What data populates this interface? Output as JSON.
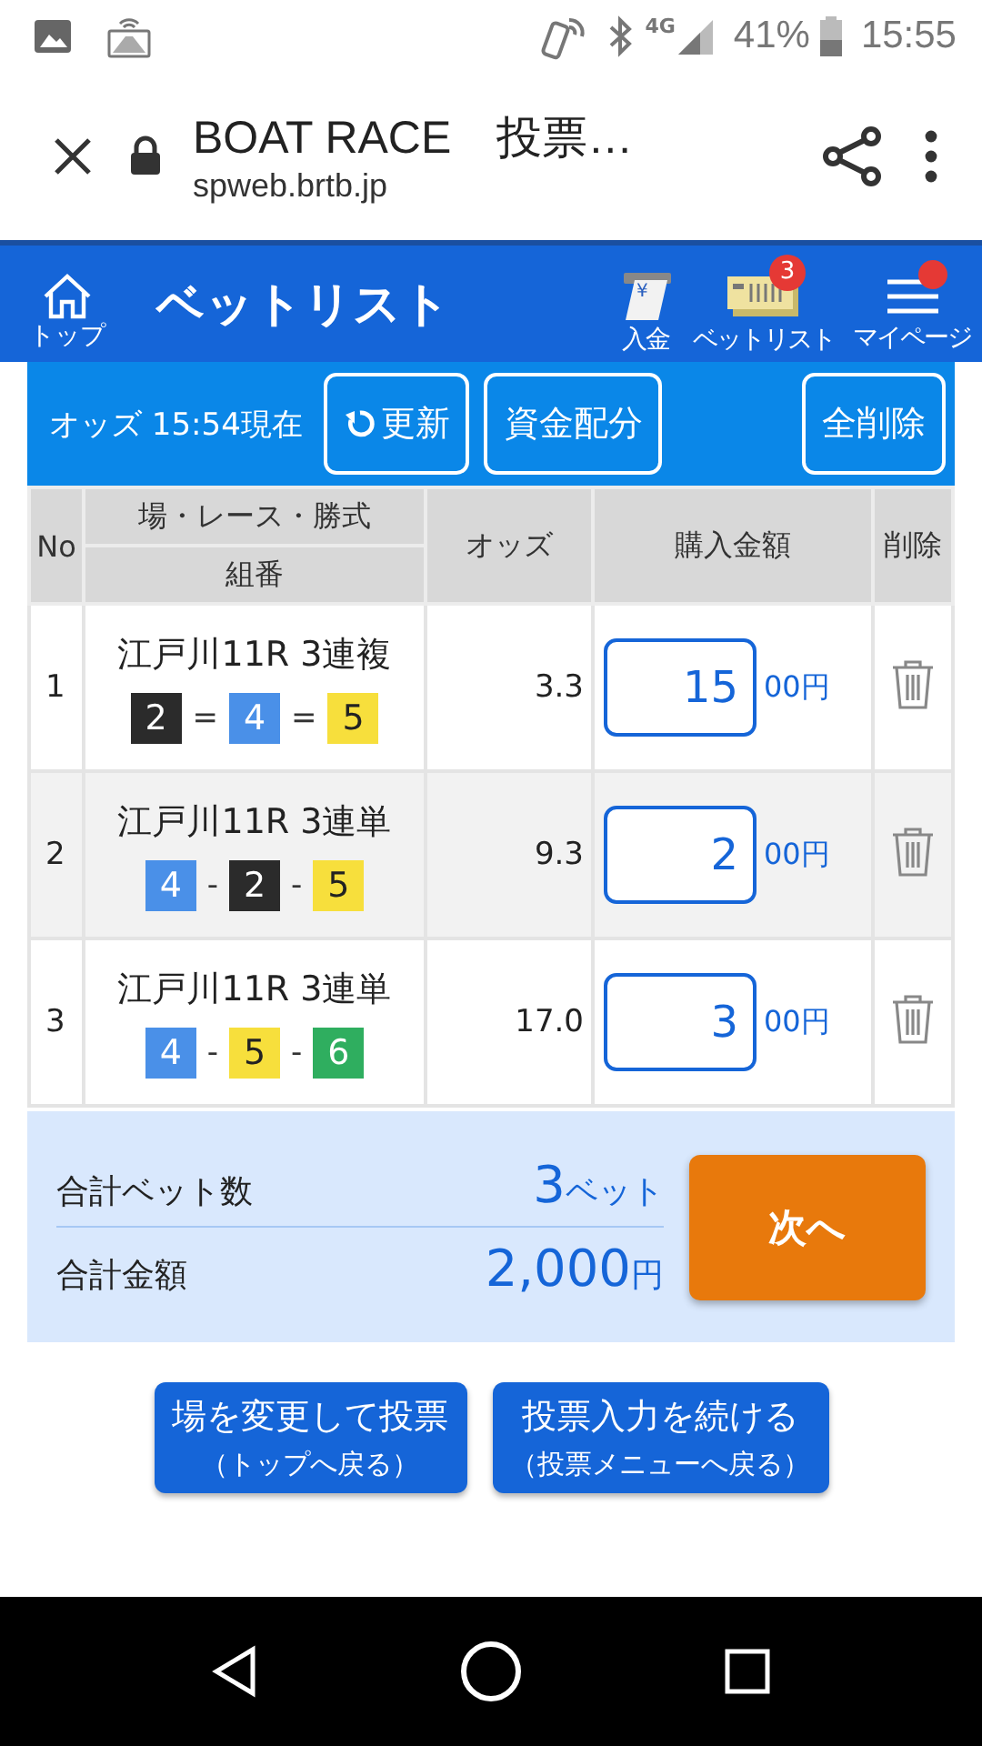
{
  "status_bar": {
    "network": "4G",
    "battery": "41%",
    "time": "15:55"
  },
  "browser": {
    "title": "BOAT RACE　投票…",
    "url": "spweb.brtb.jp"
  },
  "header": {
    "home_label": "トップ",
    "title": "ベットリスト",
    "actions": [
      {
        "kind": "deposit",
        "label": "入金",
        "icon_text": "¥"
      },
      {
        "kind": "betlist",
        "label": "ベットリスト",
        "badge": "3"
      },
      {
        "kind": "menu",
        "label": "マイページ",
        "notification": true
      }
    ]
  },
  "toolbar": {
    "odds_time": "オッズ 15:54現在",
    "buttons": [
      {
        "kind": "refresh",
        "label": "更新"
      },
      {
        "kind": "plain",
        "label": "資金配分"
      },
      {
        "kind": "plain",
        "label": "全削除"
      }
    ]
  },
  "table": {
    "columns": {
      "no": "No",
      "race": "場・レース・勝式",
      "combo": "組番",
      "odds": "オッズ",
      "amount": "購入金額",
      "delete": "削除"
    },
    "rows": [
      {
        "no": "1",
        "race": "江戸川11R 3連複",
        "separator": "=",
        "combo": [
          {
            "num": "2",
            "color": "#2b2b2b"
          },
          {
            "num": "4",
            "color": "#4a90e8"
          },
          {
            "num": "5",
            "color": "#f7df3c"
          }
        ],
        "odds": "3.3",
        "amount": "15",
        "unit": "00円"
      },
      {
        "no": "2",
        "race": "江戸川11R 3連単",
        "separator": "-",
        "combo": [
          {
            "num": "4",
            "color": "#4a90e8"
          },
          {
            "num": "2",
            "color": "#2b2b2b"
          },
          {
            "num": "5",
            "color": "#f7df3c"
          }
        ],
        "odds": "9.3",
        "amount": "2",
        "unit": "00円"
      },
      {
        "no": "3",
        "race": "江戸川11R 3連単",
        "separator": "-",
        "combo": [
          {
            "num": "4",
            "color": "#4a90e8"
          },
          {
            "num": "5",
            "color": "#f7df3c"
          },
          {
            "num": "6",
            "color": "#2fae5f"
          }
        ],
        "odds": "17.0",
        "amount": "3",
        "unit": "00円"
      }
    ]
  },
  "summary": {
    "bets_label": "合計ベット数",
    "bets_value": "3",
    "bets_unit": "ベット",
    "total_label": "合計金額",
    "total_value": "2,000",
    "total_unit": "円",
    "next_button": "次へ"
  },
  "bottom_buttons": [
    {
      "label": "場を変更して投票",
      "sub": "（トップへ戻る）"
    },
    {
      "label": "投票入力を続ける",
      "sub": "（投票メニューへ戻る）"
    }
  ]
}
